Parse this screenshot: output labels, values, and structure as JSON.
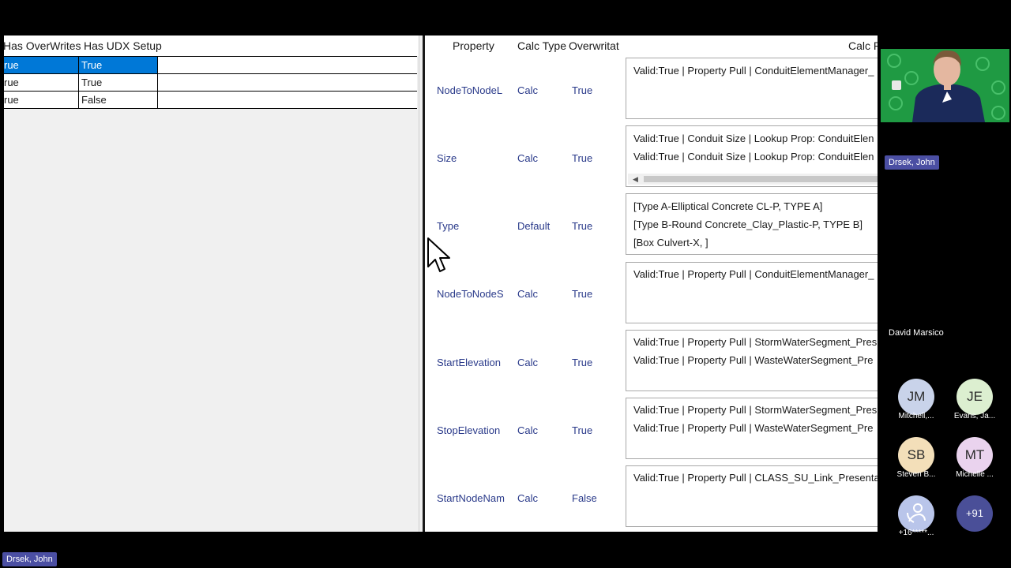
{
  "left_grid": {
    "headers": [
      "Has OverWrites",
      "Has UDX Setup"
    ],
    "rows": [
      {
        "overwrites": "rue",
        "udx": "True",
        "selected": true
      },
      {
        "overwrites": "rue",
        "udx": "True",
        "selected": false
      },
      {
        "overwrites": "rue",
        "udx": "False",
        "selected": false
      }
    ]
  },
  "right_grid": {
    "headers": {
      "property": "Property",
      "calc_type": "Calc Type",
      "overwritable": "Overwritat",
      "calc": "Calc P"
    },
    "rows": [
      {
        "property": "NodeToNodeL",
        "calc_type": "Calc",
        "overwritable": "True",
        "calc_lines": [
          "Valid:True | Property Pull | ConduitElementManager_"
        ],
        "scrollbar": false
      },
      {
        "property": "Size",
        "calc_type": "Calc",
        "overwritable": "True",
        "calc_lines": [
          "Valid:True | Conduit Size | Lookup Prop: ConduitElen",
          "Valid:True | Conduit Size | Lookup Prop: ConduitElen"
        ],
        "scrollbar": true
      },
      {
        "property": "Type",
        "calc_type": "Default",
        "overwritable": "True",
        "calc_lines": [
          "[Type A-Elliptical Concrete CL-P, TYPE A]",
          "[Type B-Round Concrete_Clay_Plastic-P, TYPE B]",
          "[Box Culvert-X, ]"
        ],
        "scrollbar": false
      },
      {
        "property": "NodeToNodeS",
        "calc_type": "Calc",
        "overwritable": "True",
        "calc_lines": [
          "Valid:True | Property Pull | ConduitElementManager_"
        ],
        "scrollbar": false
      },
      {
        "property": "StartElevation",
        "calc_type": "Calc",
        "overwritable": "True",
        "calc_lines": [
          "Valid:True | Property Pull | StormWaterSegment_Pres",
          "Valid:True | Property Pull | WasteWaterSegment_Pre"
        ],
        "scrollbar": false
      },
      {
        "property": "StopElevation",
        "calc_type": "Calc",
        "overwritable": "True",
        "calc_lines": [
          "Valid:True | Property Pull | StormWaterSegment_Pres",
          "Valid:True | Property Pull | WasteWaterSegment_Pre"
        ],
        "scrollbar": false
      },
      {
        "property": "StartNodeNam",
        "calc_type": "Calc",
        "overwritable": "False",
        "calc_lines": [
          "Valid:True | Property Pull | CLASS_SU_Link_Presentat"
        ],
        "scrollbar": false
      }
    ]
  },
  "meeting": {
    "presenter_tag": "Drsek, John",
    "video_name_tag": "Drsek, John",
    "david_label": "David Marsico",
    "participants": [
      {
        "initials": "JM",
        "name": "Mitchell,...",
        "color": "#c9d3ea"
      },
      {
        "initials": "JE",
        "name": "Evans, Ja...",
        "color": "#dcefd0"
      },
      {
        "initials": "SB",
        "name": "Steven B...",
        "color": "#f3dfb9"
      },
      {
        "initials": "MT",
        "name": "Michelle ...",
        "color": "#ead3ee"
      },
      {
        "initials": "",
        "name": "+16*****...",
        "color": "#b9c5ea",
        "icon": "phone-user-icon"
      },
      {
        "initials": "+91",
        "name": "",
        "color": "#4a4f98"
      }
    ]
  }
}
